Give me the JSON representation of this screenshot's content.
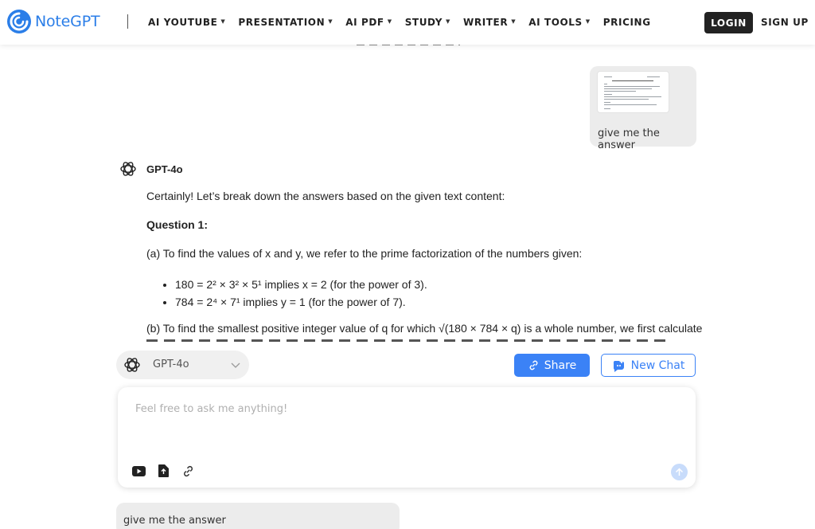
{
  "brand": {
    "name": "NoteGPT",
    "accent": "#2b7ee8"
  },
  "nav": {
    "items": [
      {
        "label": "AI YOUTUBE",
        "has_dropdown": true
      },
      {
        "label": "PRESENTATION",
        "has_dropdown": true
      },
      {
        "label": "AI PDF",
        "has_dropdown": true
      },
      {
        "label": "STUDY",
        "has_dropdown": true
      },
      {
        "label": "WRITER",
        "has_dropdown": true
      },
      {
        "label": "AI TOOLS",
        "has_dropdown": true
      },
      {
        "label": "PRICING",
        "has_dropdown": false
      }
    ],
    "login": "LOGIN",
    "signup": "SIGN UP"
  },
  "conversation": {
    "user_message": "give me the answer",
    "attachment_icon": "document-thumbnail",
    "assistant": {
      "model_name": "GPT-4o",
      "icon": "openai-icon",
      "intro": "Certainly! Let’s break down the answers based on the given text content:",
      "question_heading": "Question 1:",
      "part_a": "(a) To find the values of x and y, we refer to the prime factorization of the numbers given:",
      "bullets": [
        "180 = 2² × 3² × 5¹ implies x = 2 (for the power of 3).",
        "784 = 2⁴ × 7¹ implies y = 1 (for the power of 7)."
      ],
      "part_b": "(b) To find the smallest positive integer value of q for which √(180 × 784 × q) is a whole number, we first calculate"
    }
  },
  "controls": {
    "model_selector": "GPT-4o",
    "share_label": "Share",
    "new_chat_label": "New Chat",
    "primary_color": "#3b82f6"
  },
  "composer": {
    "placeholder": "Feel free to ask me anything!",
    "tools": [
      "youtube-icon",
      "document-upload-icon",
      "link-icon"
    ]
  },
  "history_preview": {
    "text": "give me the answer"
  }
}
